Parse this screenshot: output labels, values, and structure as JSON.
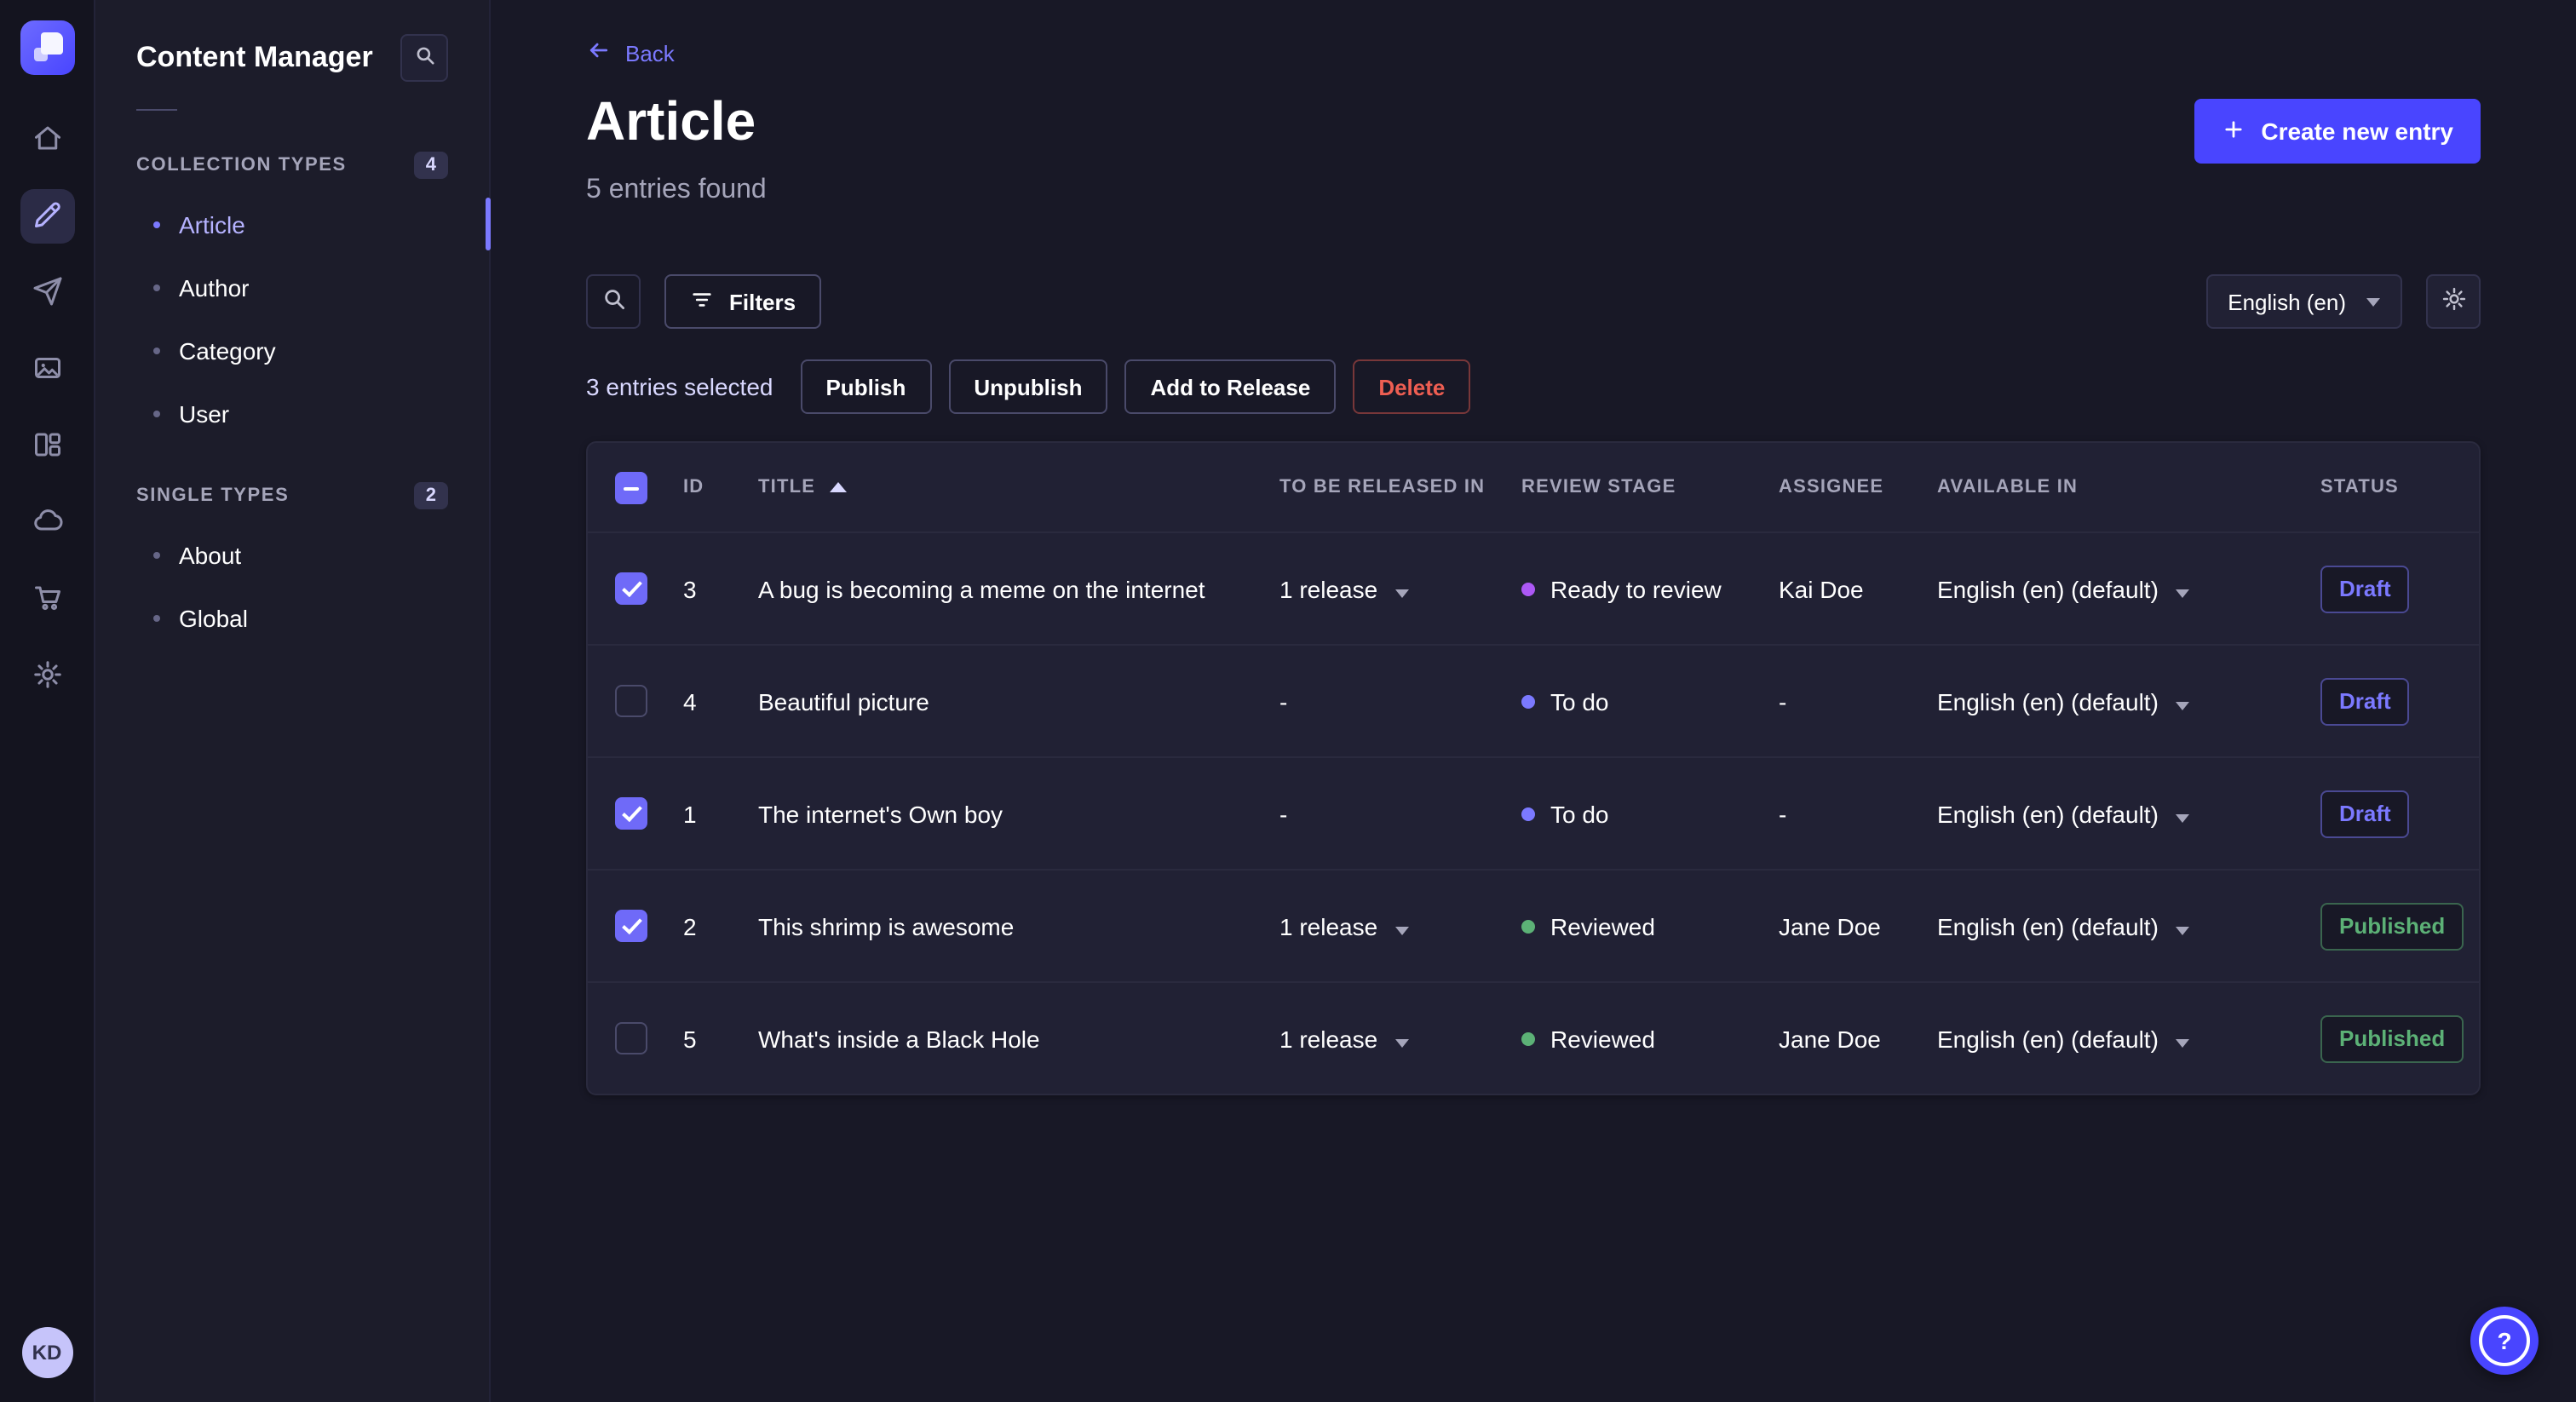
{
  "rail": {
    "avatar": "KD",
    "icons": [
      "home-icon",
      "content-manager-icon",
      "releases-icon",
      "media-library-icon",
      "content-type-builder-icon",
      "cloud-icon",
      "marketplace-icon",
      "settings-icon"
    ]
  },
  "sidebar": {
    "title": "Content Manager",
    "sections": [
      {
        "label": "COLLECTION TYPES",
        "badge": "4",
        "items": [
          {
            "label": "Article",
            "active": true
          },
          {
            "label": "Author",
            "active": false
          },
          {
            "label": "Category",
            "active": false
          },
          {
            "label": "User",
            "active": false
          }
        ]
      },
      {
        "label": "SINGLE TYPES",
        "badge": "2",
        "items": [
          {
            "label": "About",
            "active": false
          },
          {
            "label": "Global",
            "active": false
          }
        ]
      }
    ]
  },
  "header": {
    "back": "Back",
    "title": "Article",
    "subtitle": "5 entries found",
    "create_button": "Create new entry"
  },
  "toolbar": {
    "filters": "Filters",
    "locale": "English (en)"
  },
  "selection": {
    "text": "3 entries selected",
    "publish": "Publish",
    "unpublish": "Unpublish",
    "add_to_release": "Add to Release",
    "delete": "Delete"
  },
  "table": {
    "headers": {
      "id": "ID",
      "title": "TITLE",
      "release": "TO BE RELEASED IN",
      "review": "REVIEW STAGE",
      "assignee": "ASSIGNEE",
      "available": "AVAILABLE IN",
      "status": "STATUS"
    },
    "rows": [
      {
        "checked": true,
        "id": "3",
        "title": "A bug is becoming a meme on the internet",
        "release": "1 release",
        "stage": "Ready to review",
        "stage_color": "#ac58f5",
        "assignee": "Kai Doe",
        "available": "English (en) (default)",
        "status": "Draft"
      },
      {
        "checked": false,
        "id": "4",
        "title": "Beautiful picture",
        "release": "-",
        "stage": "To do",
        "stage_color": "#7b79ff",
        "assignee": "-",
        "available": "English (en) (default)",
        "status": "Draft"
      },
      {
        "checked": true,
        "id": "1",
        "title": "The internet's Own boy",
        "release": "-",
        "stage": "To do",
        "stage_color": "#7b79ff",
        "assignee": "-",
        "available": "English (en) (default)",
        "status": "Draft"
      },
      {
        "checked": true,
        "id": "2",
        "title": "This shrimp is awesome",
        "release": "1 release",
        "stage": "Reviewed",
        "stage_color": "#5cb176",
        "assignee": "Jane Doe",
        "available": "English (en) (default)",
        "status": "Published"
      },
      {
        "checked": false,
        "id": "5",
        "title": "What's inside a Black Hole",
        "release": "1 release",
        "stage": "Reviewed",
        "stage_color": "#5cb176",
        "assignee": "Jane Doe",
        "available": "English (en) (default)",
        "status": "Published"
      }
    ]
  },
  "help": {
    "icon": "?"
  },
  "colors": {
    "accent": "#4945ff",
    "link": "#7b79ff",
    "draft": "#7b79ff",
    "published": "#5cb176",
    "stage_ready": "#ac58f5",
    "stage_todo": "#7b79ff",
    "stage_reviewed": "#5cb176"
  }
}
